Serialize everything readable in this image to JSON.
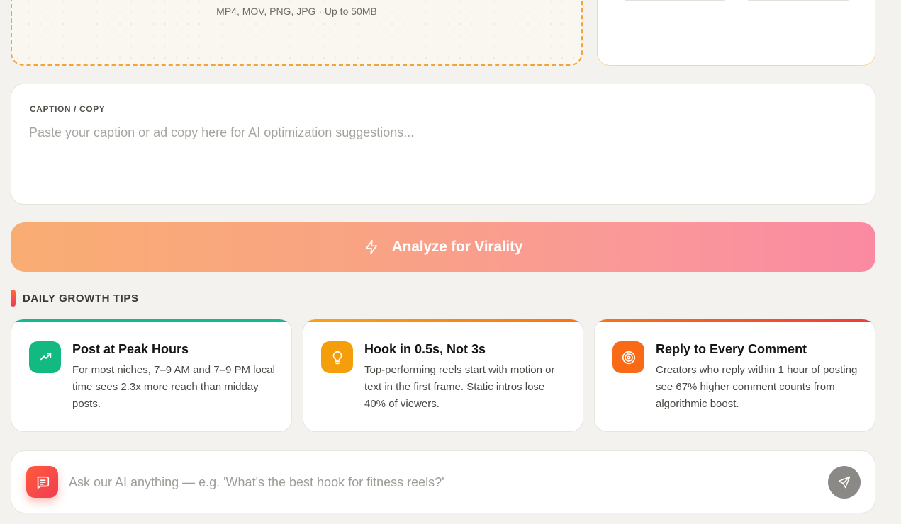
{
  "upload": {
    "formats_text": "MP4, MOV, PNG, JPG · Up to 50MB"
  },
  "caption": {
    "label": "CAPTION / COPY",
    "placeholder": "Paste your caption or ad copy here for AI optimization suggestions...",
    "value": ""
  },
  "analyze": {
    "label": "Analyze for Virality",
    "icon": "bolt-icon"
  },
  "tips_section": {
    "title": "DAILY GROWTH TIPS",
    "tips": [
      {
        "title": "Post at Peak Hours",
        "description": "For most niches, 7–9 AM and 7–9 PM local time sees 2.3x more reach than midday posts.",
        "icon": "trending-up-icon",
        "color": "#10b981"
      },
      {
        "title": "Hook in 0.5s, Not 3s",
        "description": "Top-performing reels start with motion or text in the first frame. Static intros lose 40% of viewers.",
        "icon": "lightbulb-icon",
        "color": "#f59e0b"
      },
      {
        "title": "Reply to Every Comment",
        "description": "Creators who reply within 1 hour of posting see 67% higher comment counts from algorithmic boost.",
        "icon": "target-icon",
        "color": "#f97316"
      }
    ]
  },
  "chat": {
    "placeholder": "Ask our AI anything — e.g. 'What's the best hook for fitness reels?'",
    "value": "",
    "icon": "message-icon",
    "send_icon": "send-icon"
  }
}
